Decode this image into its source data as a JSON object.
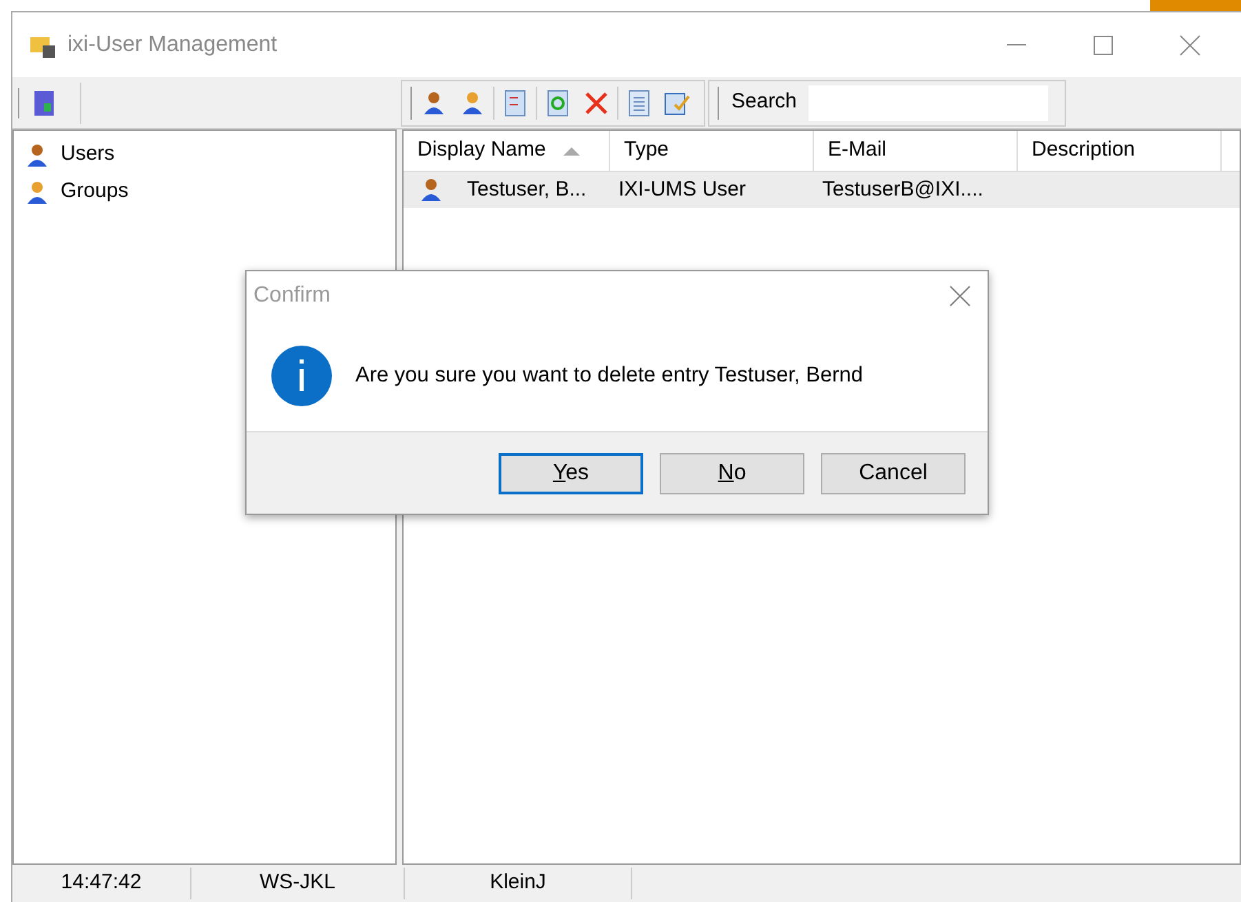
{
  "window": {
    "title": "ixi-User Management"
  },
  "tree": [
    {
      "label": "Users",
      "kind": "user"
    },
    {
      "label": "Groups",
      "kind": "group"
    }
  ],
  "search": {
    "label": "Search"
  },
  "table": {
    "columns": [
      {
        "label": "Display Name",
        "sorted": true
      },
      {
        "label": "Type",
        "sorted": false
      },
      {
        "label": "E-Mail",
        "sorted": false
      },
      {
        "label": "Description",
        "sorted": false
      }
    ],
    "rows": [
      {
        "cells": [
          "Testuser, B...",
          "IXI-UMS User",
          "TestuserB@IXI....",
          ""
        ],
        "selected": true
      }
    ]
  },
  "dialog": {
    "title": "Confirm",
    "message": "Are you sure you want to delete entry Testuser, Bernd",
    "buttons": [
      {
        "label": "Yes",
        "mnemonic": true,
        "focused": true
      },
      {
        "label": "No",
        "mnemonic": true,
        "focused": false
      },
      {
        "label": "Cancel",
        "mnemonic": false,
        "focused": false
      }
    ]
  },
  "status_bar": [
    "14:47:42",
    "WS-JKL",
    "KleinJ"
  ]
}
